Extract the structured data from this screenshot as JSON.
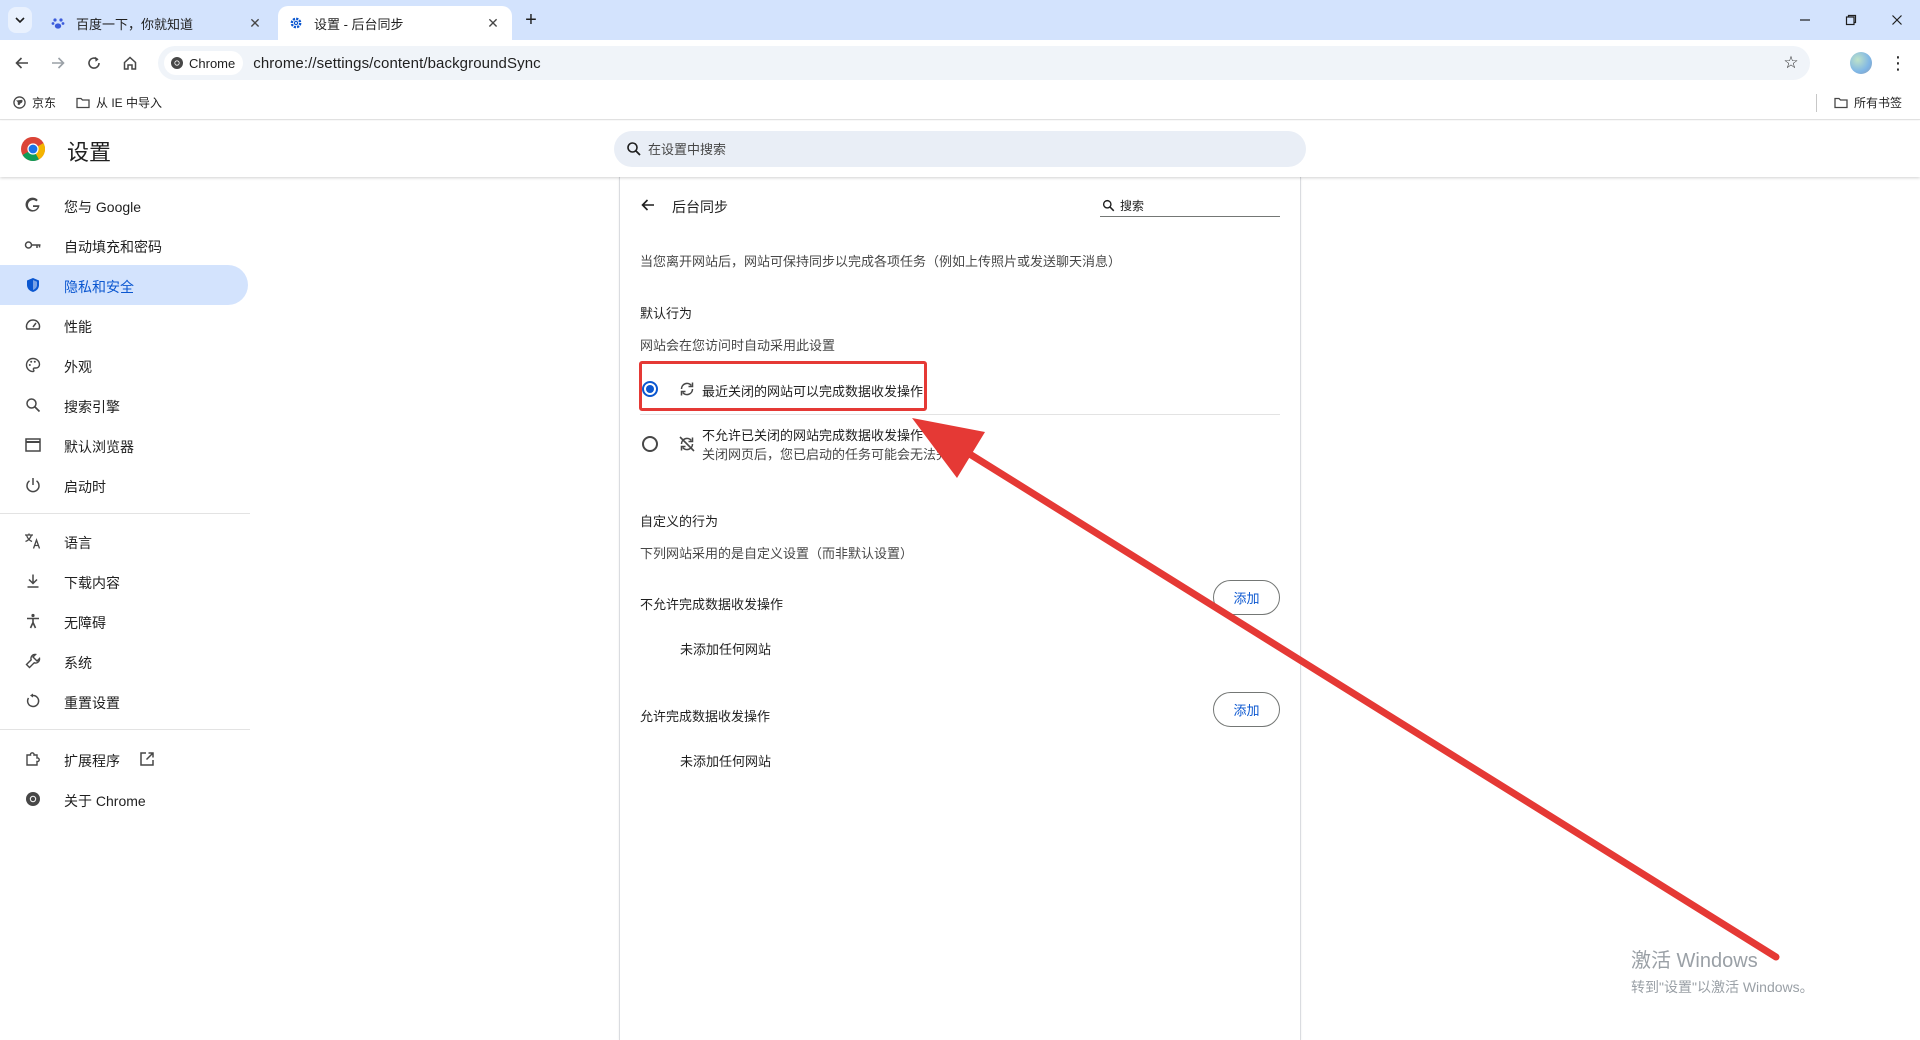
{
  "tabs": [
    {
      "title": "百度一下，你就知道",
      "active": false,
      "favicon": "baidu-paw-icon"
    },
    {
      "title": "设置 - 后台同步",
      "active": true,
      "favicon": "gear-icon"
    }
  ],
  "toolbar": {
    "chip_label": "Chrome",
    "url": "chrome://settings/content/backgroundSync"
  },
  "bookmarks": {
    "items": [
      "京东",
      "从 IE 中导入"
    ],
    "all_bookmarks": "所有书签"
  },
  "settings_header": {
    "title": "设置",
    "search_placeholder": "在设置中搜索"
  },
  "sidebar": {
    "items": [
      {
        "label": "您与 Google",
        "icon": "google-g-icon"
      },
      {
        "label": "自动填充和密码",
        "icon": "key-icon"
      },
      {
        "label": "隐私和安全",
        "icon": "shield-icon",
        "selected": true
      },
      {
        "label": "性能",
        "icon": "speedometer-icon"
      },
      {
        "label": "外观",
        "icon": "palette-icon"
      },
      {
        "label": "搜索引擎",
        "icon": "search-icon"
      },
      {
        "label": "默认浏览器",
        "icon": "browser-window-icon"
      },
      {
        "label": "启动时",
        "icon": "power-icon"
      },
      {
        "label": "语言",
        "icon": "translate-icon"
      },
      {
        "label": "下载内容",
        "icon": "download-icon"
      },
      {
        "label": "无障碍",
        "icon": "accessibility-icon"
      },
      {
        "label": "系统",
        "icon": "wrench-icon"
      },
      {
        "label": "重置设置",
        "icon": "reset-icon"
      },
      {
        "label": "扩展程序",
        "icon": "puzzle-icon"
      },
      {
        "label": "关于 Chrome",
        "icon": "chrome-icon"
      }
    ]
  },
  "page": {
    "title": "后台同步",
    "search_placeholder": "搜索",
    "description": "当您离开网站后，网站可保持同步以完成各项任务（例如上传照片或发送聊天消息）",
    "default_section_title": "默认行为",
    "default_section_subtitle": "网站会在您访问时自动采用此设置",
    "options": [
      {
        "label": "最近关闭的网站可以完成数据收发操作",
        "sublabel": "",
        "checked": true,
        "icon": "sync-icon"
      },
      {
        "label": "不允许已关闭的网站完成数据收发操作",
        "sublabel": "关闭网页后，您已启动的任务可能会无法完成",
        "checked": false,
        "icon": "sync-disabled-icon"
      }
    ],
    "custom_section_title": "自定义的行为",
    "custom_section_subtitle": "下列网站采用的是自定义设置（而非默认设置）",
    "block_title": "不允许完成数据收发操作",
    "block_add": "添加",
    "block_empty": "未添加任何网站",
    "allow_title": "允许完成数据收发操作",
    "allow_add": "添加",
    "allow_empty": "未添加任何网站"
  },
  "watermark": {
    "line1": "激活 Windows",
    "line2": "转到\"设置\"以激活 Windows。"
  },
  "colors": {
    "accent": "#0b57d0",
    "tabstrip": "#d3e3fd",
    "annotation_red": "#e53935"
  }
}
